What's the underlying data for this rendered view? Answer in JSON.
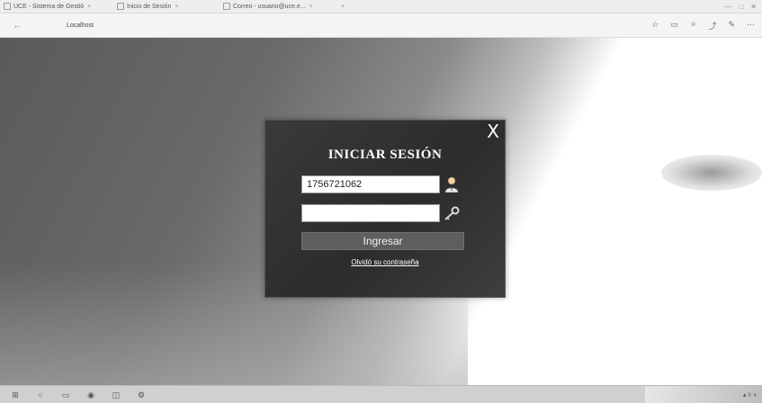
{
  "browser": {
    "tabs": [
      {
        "label": "UCE - Sistema de Gestió"
      },
      {
        "label": "Inicio de Sesión"
      },
      {
        "label": "Correo - usuario@uce.e..."
      }
    ],
    "new_tab_symbol": "+",
    "window_controls": [
      "—",
      "□",
      "✕"
    ],
    "back_symbol": "←",
    "address": "Localhost"
  },
  "login": {
    "title": "INICIAR SESIÓN",
    "close_symbol": "X",
    "username_value": "1756721062",
    "password_value": "",
    "submit_label": "Ingresar",
    "forgot_label": "Olvidó su contraseña"
  },
  "icons": {
    "user": "user-icon",
    "key": "key-icon",
    "close": "close-icon"
  },
  "colors": {
    "modal_bg": "#2c2c2c",
    "button_bg": "#5e5e5e",
    "title": "#ffffff"
  }
}
